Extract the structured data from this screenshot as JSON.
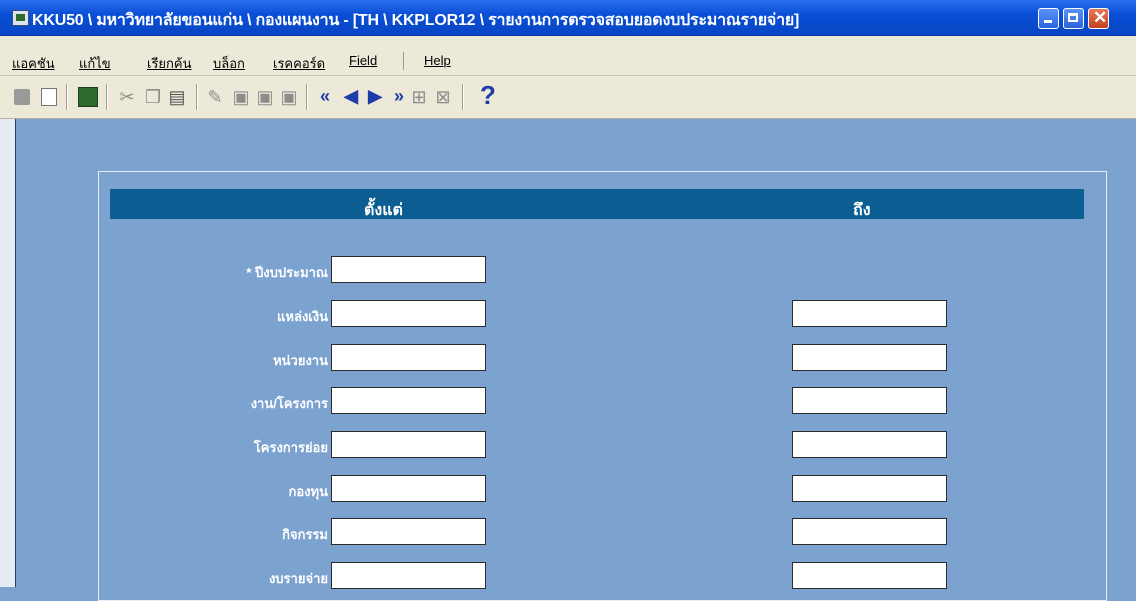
{
  "window": {
    "title": "KKU50 \\ มหาวิทยาลัยขอนแก่น \\ กองแผนงาน - [TH \\ KKPLOR12 \\ รายงานการตรวจสอบยอดงบประมาณรายจ่าย]"
  },
  "menu": {
    "items": [
      "แอคชัน",
      "แก้ไข",
      "เรียกค้น",
      "บล็อก",
      "เรคคอร์ด",
      "Field",
      "Help"
    ]
  },
  "toolbar": {
    "help_symbol": "?"
  },
  "form": {
    "header_from": "ตั้งแต่",
    "header_to": "ถึง",
    "fields": [
      {
        "label": "* ปีงบประมาณ",
        "from_value": "",
        "has_to": false
      },
      {
        "label": "แหล่งเงิน",
        "from_value": "",
        "to_value": "",
        "has_to": true
      },
      {
        "label": "หน่วยงาน",
        "from_value": "",
        "to_value": "",
        "has_to": true
      },
      {
        "label": "งาน/โครงการ",
        "from_value": "",
        "to_value": "",
        "has_to": true
      },
      {
        "label": "โครงการย่อย",
        "from_value": "",
        "to_value": "",
        "has_to": true
      },
      {
        "label": "กองทุน",
        "from_value": "",
        "to_value": "",
        "has_to": true
      },
      {
        "label": "กิจกรรม",
        "from_value": "",
        "to_value": "",
        "has_to": true
      },
      {
        "label": "งบรายจ่าย",
        "from_value": "",
        "to_value": "",
        "has_to": true
      }
    ]
  },
  "colors": {
    "background": "#7ca3cf",
    "header_band": "#0c5d92",
    "titlebar": "#0a4fd6"
  }
}
